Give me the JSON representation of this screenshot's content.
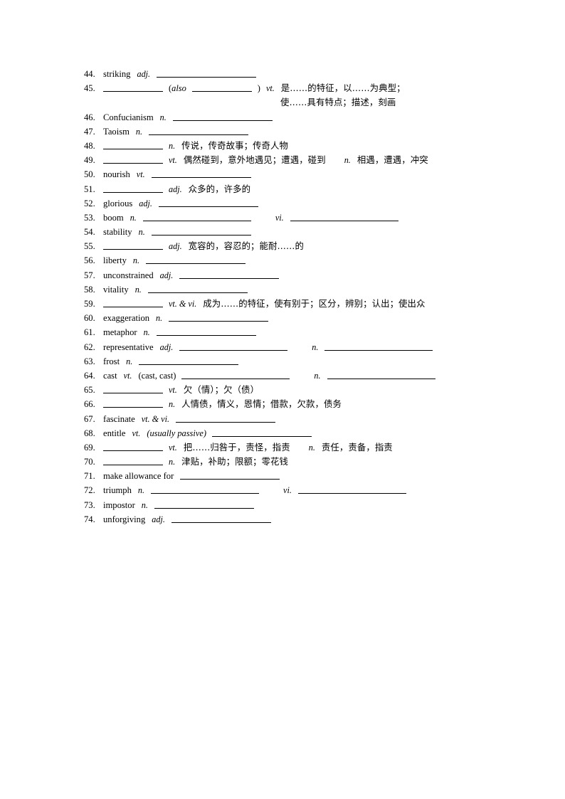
{
  "document": {
    "type": "vocabulary-fill-in-worksheet",
    "language_pair": "English-Chinese",
    "entries": [
      {
        "number": "44.",
        "word": "striking",
        "parts": [
          {
            "kind": "pos",
            "text": "adj.",
            "italic": true
          },
          {
            "kind": "blank",
            "size": "long"
          }
        ]
      },
      {
        "number": "45.",
        "word": "",
        "parts": [
          {
            "kind": "blank",
            "size": "short"
          },
          {
            "kind": "paren-open",
            "text": "("
          },
          {
            "kind": "paren-italic",
            "text": "also"
          },
          {
            "kind": "blank",
            "size": "short"
          },
          {
            "kind": "paren-close",
            "text": ")"
          },
          {
            "kind": "pos",
            "text": "vt.",
            "italic": true
          },
          {
            "kind": "cn",
            "text": "是……的特征，以……为典型；"
          }
        ],
        "continuation": "使……具有特点；描述，刻画"
      },
      {
        "number": "46.",
        "word": "Confucianism",
        "parts": [
          {
            "kind": "pos",
            "text": "n.",
            "italic": true
          },
          {
            "kind": "blank",
            "size": "long"
          }
        ]
      },
      {
        "number": "47.",
        "word": "Taoism",
        "parts": [
          {
            "kind": "pos",
            "text": "n.",
            "italic": true
          },
          {
            "kind": "blank",
            "size": "long"
          }
        ]
      },
      {
        "number": "48.",
        "word": "",
        "parts": [
          {
            "kind": "blank",
            "size": "short"
          },
          {
            "kind": "pos",
            "text": "n.",
            "italic": true
          },
          {
            "kind": "cn",
            "text": "传说，传奇故事；传奇人物"
          }
        ]
      },
      {
        "number": "49.",
        "word": "",
        "parts": [
          {
            "kind": "blank",
            "size": "short"
          },
          {
            "kind": "pos",
            "text": "vt.",
            "italic": true
          },
          {
            "kind": "cn",
            "text": "偶然碰到，意外地遇见；遭遇，碰到"
          },
          {
            "kind": "pos2",
            "text": "n.",
            "italic": true
          },
          {
            "kind": "cn",
            "text": "相遇，遭遇，冲突"
          }
        ]
      },
      {
        "number": "50.",
        "word": "nourish",
        "parts": [
          {
            "kind": "pos",
            "text": "vt.",
            "italic": true
          },
          {
            "kind": "blank",
            "size": "long"
          }
        ]
      },
      {
        "number": "51.",
        "word": "",
        "parts": [
          {
            "kind": "blank",
            "size": "short"
          },
          {
            "kind": "pos",
            "text": "adj.",
            "italic": true
          },
          {
            "kind": "cn",
            "text": "众多的，许多的"
          }
        ]
      },
      {
        "number": "52.",
        "word": "glorious",
        "parts": [
          {
            "kind": "pos",
            "text": "adj.",
            "italic": true
          },
          {
            "kind": "blank",
            "size": "long"
          }
        ]
      },
      {
        "number": "53.",
        "word": "boom",
        "parts": [
          {
            "kind": "pos",
            "text": "n.",
            "italic": true
          },
          {
            "kind": "blank",
            "size": "xlong"
          },
          {
            "kind": "pos2",
            "text": "vi.",
            "italic": true
          },
          {
            "kind": "blank",
            "size": "xlong"
          }
        ]
      },
      {
        "number": "54.",
        "word": "stability",
        "parts": [
          {
            "kind": "pos",
            "text": "n.",
            "italic": true
          },
          {
            "kind": "blank",
            "size": "long"
          }
        ]
      },
      {
        "number": "55.",
        "word": "",
        "parts": [
          {
            "kind": "blank",
            "size": "short"
          },
          {
            "kind": "pos",
            "text": "adj.",
            "italic": true
          },
          {
            "kind": "cn",
            "text": "宽容的，容忍的；能耐……的"
          }
        ]
      },
      {
        "number": "56.",
        "word": "liberty",
        "parts": [
          {
            "kind": "pos",
            "text": "n.",
            "italic": true
          },
          {
            "kind": "blank",
            "size": "long"
          }
        ]
      },
      {
        "number": "57.",
        "word": "unconstrained",
        "parts": [
          {
            "kind": "pos",
            "text": "adj.",
            "italic": true
          },
          {
            "kind": "blank",
            "size": "long"
          }
        ]
      },
      {
        "number": "58.",
        "word": "vitality",
        "parts": [
          {
            "kind": "pos",
            "text": "n.",
            "italic": true
          },
          {
            "kind": "blank",
            "size": "long"
          }
        ]
      },
      {
        "number": "59.",
        "word": "",
        "parts": [
          {
            "kind": "blank",
            "size": "short"
          },
          {
            "kind": "pos",
            "text": "vt. & vi.",
            "italic": true
          },
          {
            "kind": "cn",
            "text": "成为……的特征，使有别于；区分，辨别；认出；使出众"
          }
        ]
      },
      {
        "number": "60.",
        "word": "exaggeration",
        "parts": [
          {
            "kind": "pos",
            "text": "n.",
            "italic": true
          },
          {
            "kind": "blank",
            "size": "long"
          }
        ]
      },
      {
        "number": "61.",
        "word": "metaphor",
        "parts": [
          {
            "kind": "pos",
            "text": "n.",
            "italic": true
          },
          {
            "kind": "blank",
            "size": "long"
          }
        ]
      },
      {
        "number": "62.",
        "word": "representative",
        "parts": [
          {
            "kind": "pos",
            "text": "adj.",
            "italic": true
          },
          {
            "kind": "blank",
            "size": "xlong"
          },
          {
            "kind": "pos2",
            "text": "n.",
            "italic": true
          },
          {
            "kind": "blank",
            "size": "xlong"
          }
        ]
      },
      {
        "number": "63.",
        "word": "frost",
        "parts": [
          {
            "kind": "pos",
            "text": "n.",
            "italic": true
          },
          {
            "kind": "blank",
            "size": "long"
          }
        ]
      },
      {
        "number": "64.",
        "word": "cast",
        "parts": [
          {
            "kind": "pos",
            "text": "vt.",
            "italic": true
          },
          {
            "kind": "plain",
            "text": "(cast, cast)"
          },
          {
            "kind": "blank",
            "size": "xlong"
          },
          {
            "kind": "pos2",
            "text": "n.",
            "italic": true
          },
          {
            "kind": "blank",
            "size": "xlong"
          }
        ]
      },
      {
        "number": "65.",
        "word": "",
        "parts": [
          {
            "kind": "blank",
            "size": "short"
          },
          {
            "kind": "pos",
            "text": "vt.",
            "italic": true
          },
          {
            "kind": "cn",
            "text": "欠（情）；欠（债）"
          }
        ]
      },
      {
        "number": "66.",
        "word": "",
        "parts": [
          {
            "kind": "blank",
            "size": "short"
          },
          {
            "kind": "pos",
            "text": "n.",
            "italic": true
          },
          {
            "kind": "cn",
            "text": "人情债，情义，恩情；借款，欠款，债务"
          }
        ]
      },
      {
        "number": "67.",
        "word": "fascinate",
        "parts": [
          {
            "kind": "pos",
            "text": "vt. & vi.",
            "italic": true
          },
          {
            "kind": "blank",
            "size": "long"
          }
        ]
      },
      {
        "number": "68.",
        "word": "entitle",
        "parts": [
          {
            "kind": "pos",
            "text": "vt.",
            "italic": true
          },
          {
            "kind": "paren-italic-full",
            "text": "(usually passive)"
          },
          {
            "kind": "blank",
            "size": "long"
          }
        ]
      },
      {
        "number": "69.",
        "word": "",
        "parts": [
          {
            "kind": "blank",
            "size": "short"
          },
          {
            "kind": "pos",
            "text": "vt.",
            "italic": true
          },
          {
            "kind": "cn",
            "text": "把……归咎于，责怪，指责"
          },
          {
            "kind": "pos2",
            "text": "n.",
            "italic": true
          },
          {
            "kind": "cn",
            "text": "责任，责备，指责"
          }
        ]
      },
      {
        "number": "70.",
        "word": "",
        "parts": [
          {
            "kind": "blank",
            "size": "short"
          },
          {
            "kind": "pos",
            "text": "n.",
            "italic": true
          },
          {
            "kind": "cn",
            "text": "津贴，补助；限额；零花钱"
          }
        ]
      },
      {
        "number": "71.",
        "word": "make allowance for",
        "parts": [
          {
            "kind": "blank",
            "size": "long"
          }
        ]
      },
      {
        "number": "72.",
        "word": "triumph",
        "parts": [
          {
            "kind": "pos",
            "text": "n.",
            "italic": true
          },
          {
            "kind": "blank",
            "size": "xlong"
          },
          {
            "kind": "pos2",
            "text": "vi.",
            "italic": true
          },
          {
            "kind": "blank",
            "size": "xlong"
          }
        ]
      },
      {
        "number": "73.",
        "word": "impostor",
        "parts": [
          {
            "kind": "pos",
            "text": "n.",
            "italic": true
          },
          {
            "kind": "blank",
            "size": "long"
          }
        ]
      },
      {
        "number": "74.",
        "word": "unforgiving",
        "parts": [
          {
            "kind": "pos",
            "text": "adj.",
            "italic": true
          },
          {
            "kind": "blank",
            "size": "long"
          }
        ]
      }
    ]
  }
}
